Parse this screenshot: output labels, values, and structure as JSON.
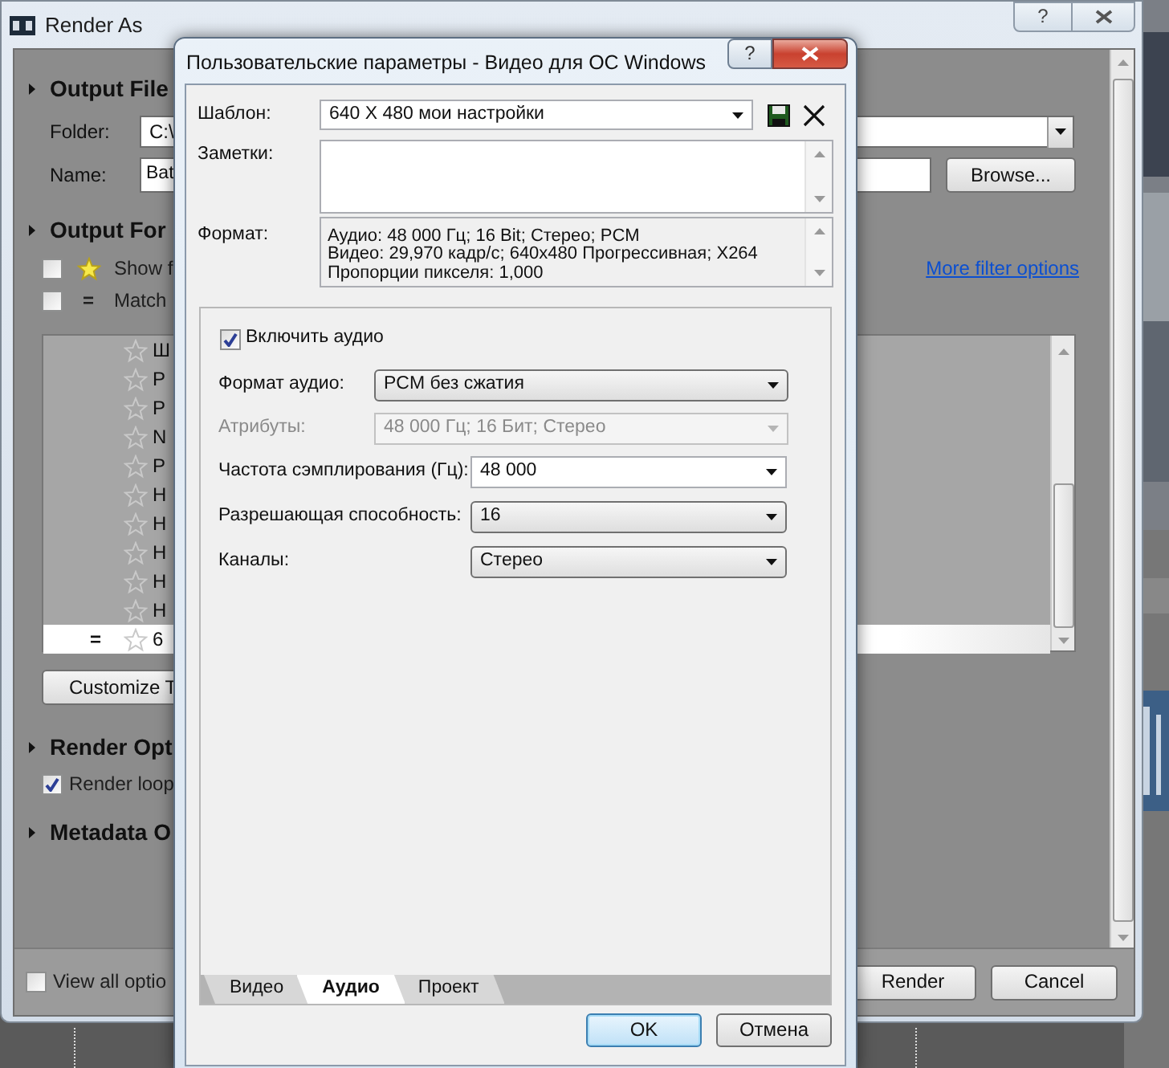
{
  "render_as": {
    "title": "Render As",
    "help_button": "?",
    "output_file": {
      "heading": "Output File",
      "folder_label": "Folder:",
      "folder_value": "C:\\",
      "name_label": "Name:",
      "name_value": "Bat",
      "browse_button": "Browse..."
    },
    "output_format": {
      "heading": "Output For",
      "filters": [
        {
          "kind": "star",
          "label": "Show f",
          "checked": false
        },
        {
          "kind": "marker",
          "marker": "=",
          "label": "Match",
          "checked": false
        }
      ],
      "more_filters_link": "More filter options",
      "templates": [
        {
          "label": "Ш",
          "selected": false
        },
        {
          "label": "P",
          "selected": false
        },
        {
          "label": "P",
          "selected": false
        },
        {
          "label": "N",
          "selected": false
        },
        {
          "label": "P",
          "selected": false
        },
        {
          "label": "H",
          "selected": false
        },
        {
          "label": "H",
          "selected": false
        },
        {
          "label": "H",
          "selected": false
        },
        {
          "label": "H",
          "selected": false
        },
        {
          "label": "H",
          "selected": false
        },
        {
          "label": "6",
          "marker": "=",
          "selected": true
        }
      ],
      "customize_button": "Customize T"
    },
    "render_options": {
      "heading": "Render Opt",
      "options": [
        {
          "label": "Render loop",
          "checked": true
        }
      ]
    },
    "metadata": {
      "heading": "Metadata O"
    },
    "view_all": {
      "label": "View all optio",
      "checked": false
    },
    "buttons": [
      "Render",
      "Cancel"
    ]
  },
  "dialog": {
    "title": "Пользовательские параметры - Видео для ОС Windows",
    "help_button": "?",
    "template": {
      "label": "Шаблон:",
      "value": "640 X 480 мои настройки"
    },
    "notes": {
      "label": "Заметки:"
    },
    "format": {
      "label": "Формат:",
      "lines": [
        "Аудио: 48 000 Гц; 16 Bit; Стерео; PCM",
        "Видео: 29,970 кадр/с; 640x480 Прогрессивная; X264",
        "Пропорции пикселя: 1,000"
      ]
    },
    "audio": {
      "enable": {
        "label": "Включить аудио",
        "checked": true
      },
      "fields": [
        {
          "label": "Формат аудио:",
          "value": "PCM без сжатия",
          "kind": "list",
          "disabled": false
        },
        {
          "label": "Атрибуты:",
          "value": "48 000 Гц; 16 Бит; Стерео",
          "kind": "list",
          "disabled": true
        },
        {
          "label": "Частота сэмплирования (Гц):",
          "value": "48 000",
          "kind": "editable",
          "disabled": false
        },
        {
          "label": "Разрешающая способность:",
          "value": "16",
          "kind": "list",
          "disabled": false
        },
        {
          "label": "Каналы:",
          "value": "Стерео",
          "kind": "list",
          "disabled": false
        }
      ]
    },
    "tabs": [
      {
        "label": "Видео",
        "selected": false
      },
      {
        "label": "Аудио",
        "selected": true
      },
      {
        "label": "Проект",
        "selected": false
      }
    ],
    "buttons": [
      {
        "label": "OK",
        "default": true
      },
      {
        "label": "Отмена",
        "default": false
      }
    ]
  }
}
